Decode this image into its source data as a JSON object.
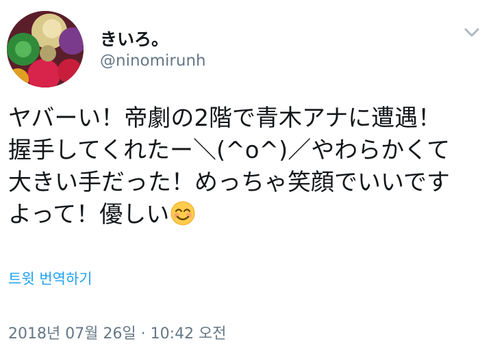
{
  "author": {
    "display_name": "きいろ。",
    "handle": "@ninomirunh"
  },
  "tweet": {
    "lines": [
      "ヤバーい！帝劇の2階で青木アナに遭遇！",
      "握手してくれたー＼(^o^)／やわらかくて",
      "大きい手だった！めっちゃ笑顔でいいです",
      "よって！優しい"
    ],
    "emoji": "smiling-face-emoji"
  },
  "translate_label": "트윗 번역하기",
  "timestamp": "2018년 07월 26일 · 10:42 오전",
  "icons": {
    "menu": "chevron-down-icon",
    "avatar": "avatar"
  },
  "colors": {
    "link": "#1da1f2",
    "muted": "#657786",
    "text": "#14171a"
  }
}
